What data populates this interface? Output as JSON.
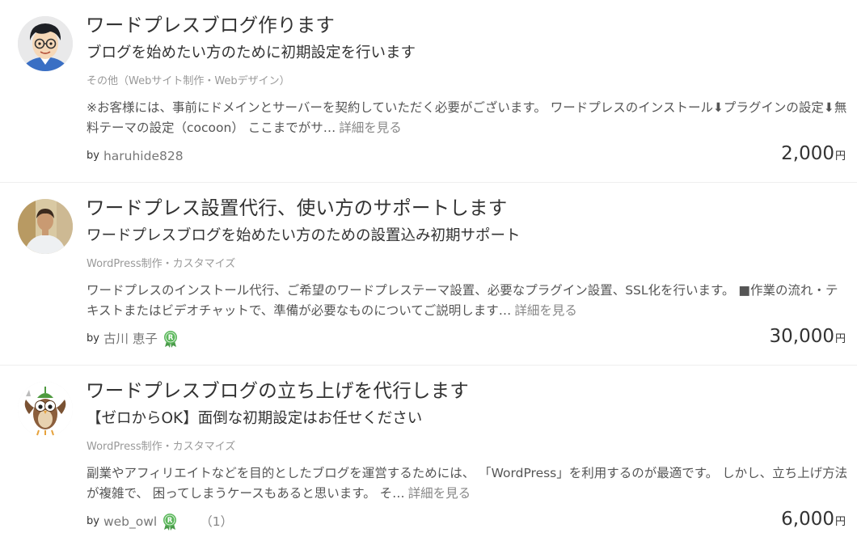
{
  "services": [
    {
      "title": "ワードプレスブログ作ります",
      "subtitle": "ブログを始めたい方のために初期設定を行います",
      "category": "その他（Webサイト制作・Webデザイン）",
      "description": "※お客様には、事前にドメインとサーバーを契約していただく必要がございます。 ワードプレスのインストール⬇プラグインの設定⬇無料テーマの設定（cocoon） ここまでがサ…",
      "more_label": "詳細を見る",
      "by_label": "by",
      "seller": "haruhide828",
      "price": "2,000",
      "currency": "円",
      "avatar_icon": "boy-with-glasses-avatar"
    },
    {
      "title": "ワードプレス設置代行、使い方のサポートします",
      "subtitle": "ワードプレスブログを始めたい方のための設置込み初期サポート",
      "category": "WordPress制作・カスタマイズ",
      "description": "ワードプレスのインストール代行、ご希望のワードプレステーマ設置、必要なプラグイン設置、SSL化を行います。 ■作業の流れ・テキストまたはビデオチャットで、準備が必要なものについてご説明します…",
      "more_label": "詳細を見る",
      "by_label": "by",
      "seller": "古川 恵子",
      "badge": "R",
      "price": "30,000",
      "currency": "円",
      "avatar_icon": "woman-photo-avatar"
    },
    {
      "title": "ワードプレスブログの立ち上げを代行します",
      "subtitle": "【ゼロからOK】面倒な初期設定はお任せください",
      "category": "WordPress制作・カスタマイズ",
      "description": "副業やアフィリエイトなどを目的としたブログを運営するためには、 「WordPress」を利用するのが最適です。 しかし、立ち上げ方法が複雑で、 困ってしまうケースもあると思います。 そ…",
      "more_label": "詳細を見る",
      "by_label": "by",
      "seller": "web_owl",
      "badge": "R",
      "reviews": "（1）",
      "price": "6,000",
      "currency": "円",
      "avatar_icon": "owl-character-avatar"
    }
  ],
  "colors": {
    "badge_green": "#5cb85c",
    "text": "#333333",
    "muted": "#999999"
  }
}
